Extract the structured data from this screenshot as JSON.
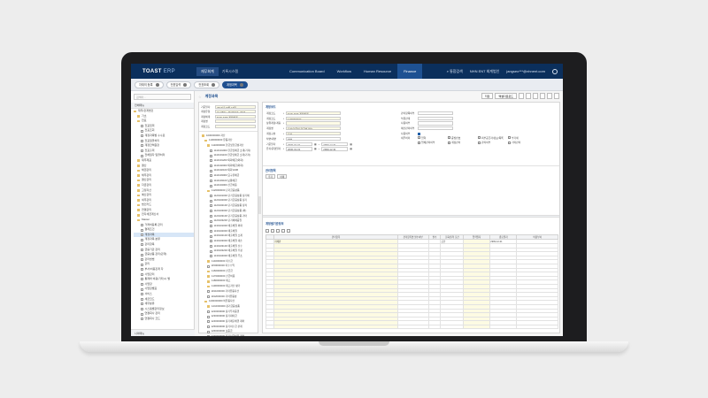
{
  "app": {
    "logo_main": "TOAST",
    "logo_sub": "ERP",
    "nav_primary": "재무회계",
    "nav_secondary": "기록시스템",
    "modules": [
      "Communication Board",
      "Workflow",
      "Human Resource",
      "Finance"
    ],
    "active_module": "Finance",
    "user_company": "NHN ENT 회계법인",
    "user_email": "jangseo***@nhnent.com"
  },
  "tabs": [
    {
      "label": "자재의 등록",
      "active": false
    },
    {
      "label": "전표입력",
      "active": false
    },
    {
      "label": "전표조회",
      "active": false
    },
    {
      "label": "계정과목",
      "active": true
    }
  ],
  "sidebar": {
    "search_placeholder": "검색어...",
    "header": "전체메뉴",
    "items": [
      {
        "label": "재무/관계법인",
        "type": "f",
        "indent": 0
      },
      {
        "label": "기초",
        "type": "f",
        "indent": 1
      },
      {
        "label": "전표",
        "type": "f",
        "indent": 1
      },
      {
        "label": "전표입력",
        "type": "d",
        "indent": 2
      },
      {
        "label": "전표조회",
        "type": "d",
        "indent": 2
      },
      {
        "label": "계정과목별 수수료",
        "type": "d",
        "indent": 2
      },
      {
        "label": "전표일괄처리",
        "type": "d",
        "indent": 2
      },
      {
        "label": "계정잔액원장",
        "type": "d",
        "indent": 2
      },
      {
        "label": "전표출력",
        "type": "d",
        "indent": 2
      },
      {
        "label": "전체일자 일괄처리",
        "type": "d",
        "indent": 2
      },
      {
        "label": "재무제표",
        "type": "f",
        "indent": 1
      },
      {
        "label": "결산",
        "type": "f",
        "indent": 1
      },
      {
        "label": "채권관리",
        "type": "f",
        "indent": 1
      },
      {
        "label": "채무관리",
        "type": "f",
        "indent": 1
      },
      {
        "label": "결산관리",
        "type": "f",
        "indent": 1
      },
      {
        "label": "자금관리",
        "type": "f",
        "indent": 1
      },
      {
        "label": "고정자산",
        "type": "f",
        "indent": 1
      },
      {
        "label": "예산관리",
        "type": "f",
        "indent": 1
      },
      {
        "label": "세무관리",
        "type": "f",
        "indent": 1
      },
      {
        "label": "법인카드",
        "type": "f",
        "indent": 1
      },
      {
        "label": "연결관리",
        "type": "f",
        "indent": 1
      },
      {
        "label": "전자세금계산서",
        "type": "f",
        "indent": 1
      },
      {
        "label": "Master",
        "type": "f",
        "indent": 1
      },
      {
        "label": "거래처등록 관리",
        "type": "d",
        "indent": 2
      },
      {
        "label": "결제조건",
        "type": "d",
        "indent": 2
      },
      {
        "label": "계정과목",
        "type": "d",
        "indent": 2,
        "sel": true
      },
      {
        "label": "계정과목 분류",
        "type": "d",
        "indent": 2
      },
      {
        "label": "관리항목",
        "type": "d",
        "indent": 2
      },
      {
        "label": "금융기관 관리",
        "type": "d",
        "indent": 2
      },
      {
        "label": "금융상품 관리(관계)",
        "type": "d",
        "indent": 2
      },
      {
        "label": "관리방법",
        "type": "d",
        "indent": 2
      },
      {
        "label": "관리",
        "type": "d",
        "indent": 2
      },
      {
        "label": "부서/비용관계 자",
        "type": "d",
        "indent": 2
      },
      {
        "label": "사업관리",
        "type": "d",
        "indent": 2
      },
      {
        "label": "통제와 비용(기타)시 별",
        "type": "d",
        "indent": 2
      },
      {
        "label": "사업장",
        "type": "d",
        "indent": 2
      },
      {
        "label": "사업장별표",
        "type": "d",
        "indent": 2
      },
      {
        "label": "서비스",
        "type": "d",
        "indent": 2
      },
      {
        "label": "세금코드",
        "type": "d",
        "indent": 2
      },
      {
        "label": "세무분류",
        "type": "d",
        "indent": 2
      },
      {
        "label": "시스템별관리정보",
        "type": "d",
        "indent": 2
      },
      {
        "label": "연결회사 관리",
        "type": "d",
        "indent": 2
      },
      {
        "label": "연결회사 코드",
        "type": "d",
        "indent": 2
      }
    ],
    "footer": "나의메뉴"
  },
  "main": {
    "title": "계정과목",
    "buttons": [
      "저장",
      "엑셀다운로드"
    ]
  },
  "tree": {
    "form": [
      {
        "label": "기준일자",
        "value": "2017년 10월 16일"
      },
      {
        "label": "계정유형",
        "value": "GLOBAL_MARKET_2015"
      },
      {
        "label": "계정체계",
        "value": "NHN ENT 계정체계"
      },
      {
        "label": "계정명",
        "value": ""
      },
      {
        "label": "계정코드",
        "value": ""
      }
    ],
    "nodes": [
      {
        "label": "1000000000 자산",
        "type": "f",
        "i": 0
      },
      {
        "label": "1100000000 유동자산",
        "type": "f",
        "i": 1
      },
      {
        "label": "1110000000 현금및현금성자산",
        "type": "f",
        "i": 2
      },
      {
        "label": "1110101000 현금및예금 소계(기각)",
        "type": "d",
        "i": 3
      },
      {
        "label": "1110101100 현금및예금 소계(기각)",
        "type": "d",
        "i": 3
      },
      {
        "label": "1110101200 외화예금(외화)",
        "type": "d",
        "i": 3
      },
      {
        "label": "1110102000 외화예금(외화)",
        "type": "d",
        "i": 3
      },
      {
        "label": "1110102100 외화 ESB",
        "type": "d",
        "i": 3
      },
      {
        "label": "1110103000 요구불예금",
        "type": "d",
        "i": 3
      },
      {
        "label": "1110103100 보통예금",
        "type": "d",
        "i": 3
      },
      {
        "label": "1110104000 선급비용",
        "type": "d",
        "i": 3
      },
      {
        "label": "1120000000 단기금융상품",
        "type": "f",
        "i": 2
      },
      {
        "label": "1120101000 단기금융상품 정기예",
        "type": "d",
        "i": 3
      },
      {
        "label": "1120102000 단기금융상품 정기",
        "type": "d",
        "i": 3
      },
      {
        "label": "1120102100 단기금융상품 정적",
        "type": "d",
        "i": 3
      },
      {
        "label": "1120103000 단기금융상품 (외)",
        "type": "d",
        "i": 3
      },
      {
        "label": "1120103100 단기금융상품 기타",
        "type": "d",
        "i": 3
      },
      {
        "label": "1120103200 단기매매증권",
        "type": "d",
        "i": 3
      },
      {
        "label": "1130101000 매출채권 외화",
        "type": "d",
        "i": 3
      },
      {
        "label": "1130102000 매출채권",
        "type": "d",
        "i": 3
      },
      {
        "label": "1130102100 매출채권 소계",
        "type": "d",
        "i": 3
      },
      {
        "label": "1130103000 매출채권 대손",
        "type": "d",
        "i": 3
      },
      {
        "label": "1130103100 매출채권 선수",
        "type": "d",
        "i": 3
      },
      {
        "label": "1130103200 매출채권 추정",
        "type": "d",
        "i": 3
      },
      {
        "label": "1130104000 매출채권 주소",
        "type": "d",
        "i": 3
      },
      {
        "label": "1140000000 미수금",
        "type": "f",
        "i": 2
      },
      {
        "label": "1150000000 미수수익",
        "type": "d",
        "i": 2
      },
      {
        "label": "1160000000 선급금",
        "type": "f",
        "i": 2
      },
      {
        "label": "1170000000 선급비용",
        "type": "f",
        "i": 2
      },
      {
        "label": "1180000000 재고",
        "type": "f",
        "i": 2
      },
      {
        "label": "1190000000 재고자산 평가",
        "type": "f",
        "i": 2
      },
      {
        "label": "1191000000 기타유동자산",
        "type": "d",
        "i": 2
      },
      {
        "label": "1192000000 기타유동성",
        "type": "d",
        "i": 2
      },
      {
        "label": "1200000000 비유동자산",
        "type": "f",
        "i": 1
      },
      {
        "label": "1210000000 장기금융상품",
        "type": "f",
        "i": 2
      },
      {
        "label": "1220000000 장기투자증권",
        "type": "d",
        "i": 2
      },
      {
        "label": "1230000000 장기대여금",
        "type": "d",
        "i": 2
      },
      {
        "label": "1240000000 장기매출채권 계좌",
        "type": "d",
        "i": 2
      },
      {
        "label": "1250000000 장기미수금 관계",
        "type": "d",
        "i": 2
      },
      {
        "label": "1260000000 보증금",
        "type": "d",
        "i": 2
      },
      {
        "label": "1270000000 장기선급비용 계좌",
        "type": "d",
        "i": 2
      }
    ]
  },
  "detail": {
    "section_title": "계정코드",
    "left_fields": [
      {
        "label": "계정코드",
        "value": "NHN ENT 계정체계",
        "style": "y"
      },
      {
        "label": "계정코드",
        "value": "1100000000",
        "style": "y"
      },
      {
        "label": "상위계정/계층",
        "value": "",
        "style": "y"
      },
      {
        "label": "계정명",
        "value": "자산(현금및 현금성자산)",
        "style": "y"
      },
      {
        "label": "계정구분",
        "value": "자산",
        "style": "y"
      },
      {
        "label": "차변/대변",
        "value": "차변",
        "style": ""
      },
      {
        "label": "기준일자",
        "value": "2000-01-01",
        "value2": "2999-12-31",
        "style": ""
      },
      {
        "label": "유지/운영일자",
        "value": "2000-01-01",
        "value2": "2999-12-31",
        "style": ""
      }
    ],
    "right_fields": [
      {
        "label": "관리항목여부",
        "value": ""
      },
      {
        "label": "부문관계",
        "value": ""
      },
      {
        "label": "사용여부",
        "value": ""
      },
      {
        "label": "예산관리여부",
        "value": ""
      },
      {
        "label": "사용여부",
        "value": ""
      }
    ],
    "options_label": "세무처리",
    "options": [
      "입력",
      "증빙번호",
      "외부공급자/정보/목록",
      "부가세",
      "업체관리여부",
      "계정관리",
      "관리여부",
      "기타관리"
    ],
    "sub_title": "관리항목",
    "sub_buttons": [
      "추가",
      "삭제"
    ],
    "grid_title": "계정별기준정보",
    "grid_headers": [
      "관리항목",
      "관리항목명 필수여부",
      "필수",
      "조회/출력 조건",
      "입력일자",
      "종료일자",
      "비용부서"
    ],
    "grid_row": {
      "col1": "자체판",
      "col4": "공란",
      "col6": "2999-12-31"
    }
  }
}
